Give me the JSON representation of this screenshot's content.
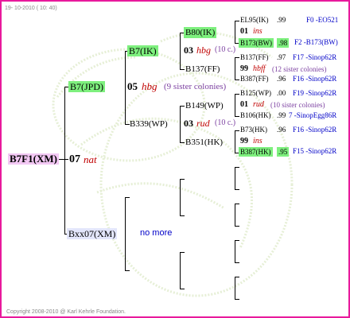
{
  "header_date": "19- 10-2010 ( 10: 40)",
  "footer": "Copyright 2008-2010 @ Karl Kehrle Foundation.",
  "subject": {
    "id": "B7F1(XM)"
  },
  "gen1": {
    "sire_num": "07",
    "sire_name": "nat",
    "sire": "B7(JPD)",
    "dam": "Bxx07(XM)",
    "dam_note": "no more"
  },
  "gen2": {
    "sire_sire": "B7(IK)",
    "sire_num": "05",
    "sire_name": "hbg",
    "sire_sisters": "(9 sister colonies)",
    "sire_dam": "B339(WP)"
  },
  "gen3": {
    "a": "B80(IK)",
    "a_num": "03",
    "a_name": "hbg",
    "a_sisters": "(10 c.)",
    "b": "B137(FF)",
    "c": "B149(WP)",
    "c_num": "03",
    "c_name": "rud",
    "c_sisters": "(10 c.)",
    "d": "B351(HK)"
  },
  "gen4": {
    "r1": {
      "id": "EL95(IK)",
      "val": ".99",
      "ref": "F0 -EO521"
    },
    "r1n": {
      "num": "01",
      "name": "ins"
    },
    "r2": {
      "id": "B173(BW)",
      "val": ".98",
      "ref": "F2 -B173(BW)"
    },
    "r3": {
      "id": "B137(FF)",
      "val": ".97",
      "ref": "F17 -Sinop62R"
    },
    "r3n": {
      "num": "99",
      "name": "hbff",
      "sisters": "(12 sister colonies)"
    },
    "r4": {
      "id": "B387(FF)",
      "val": ".96",
      "ref": "F16 -Sinop62R"
    },
    "r5": {
      "id": "B125(WP)",
      "val": ".00",
      "ref": "F19 -Sinop62R"
    },
    "r5n": {
      "num": "01",
      "name": "rud",
      "sisters": "(10 sister colonies)"
    },
    "r6": {
      "id": "B106(HK)",
      "val": ".99",
      "ref": "7 -SinopEgg86R"
    },
    "r7": {
      "id": "B73(HK)",
      "val": ".96",
      "ref": "F16 -Sinop62R"
    },
    "r7n": {
      "num": "99",
      "name": "ins"
    },
    "r8": {
      "id": "B387(HK)",
      "val": ".95",
      "ref": "F15 -Sinop62R"
    }
  }
}
